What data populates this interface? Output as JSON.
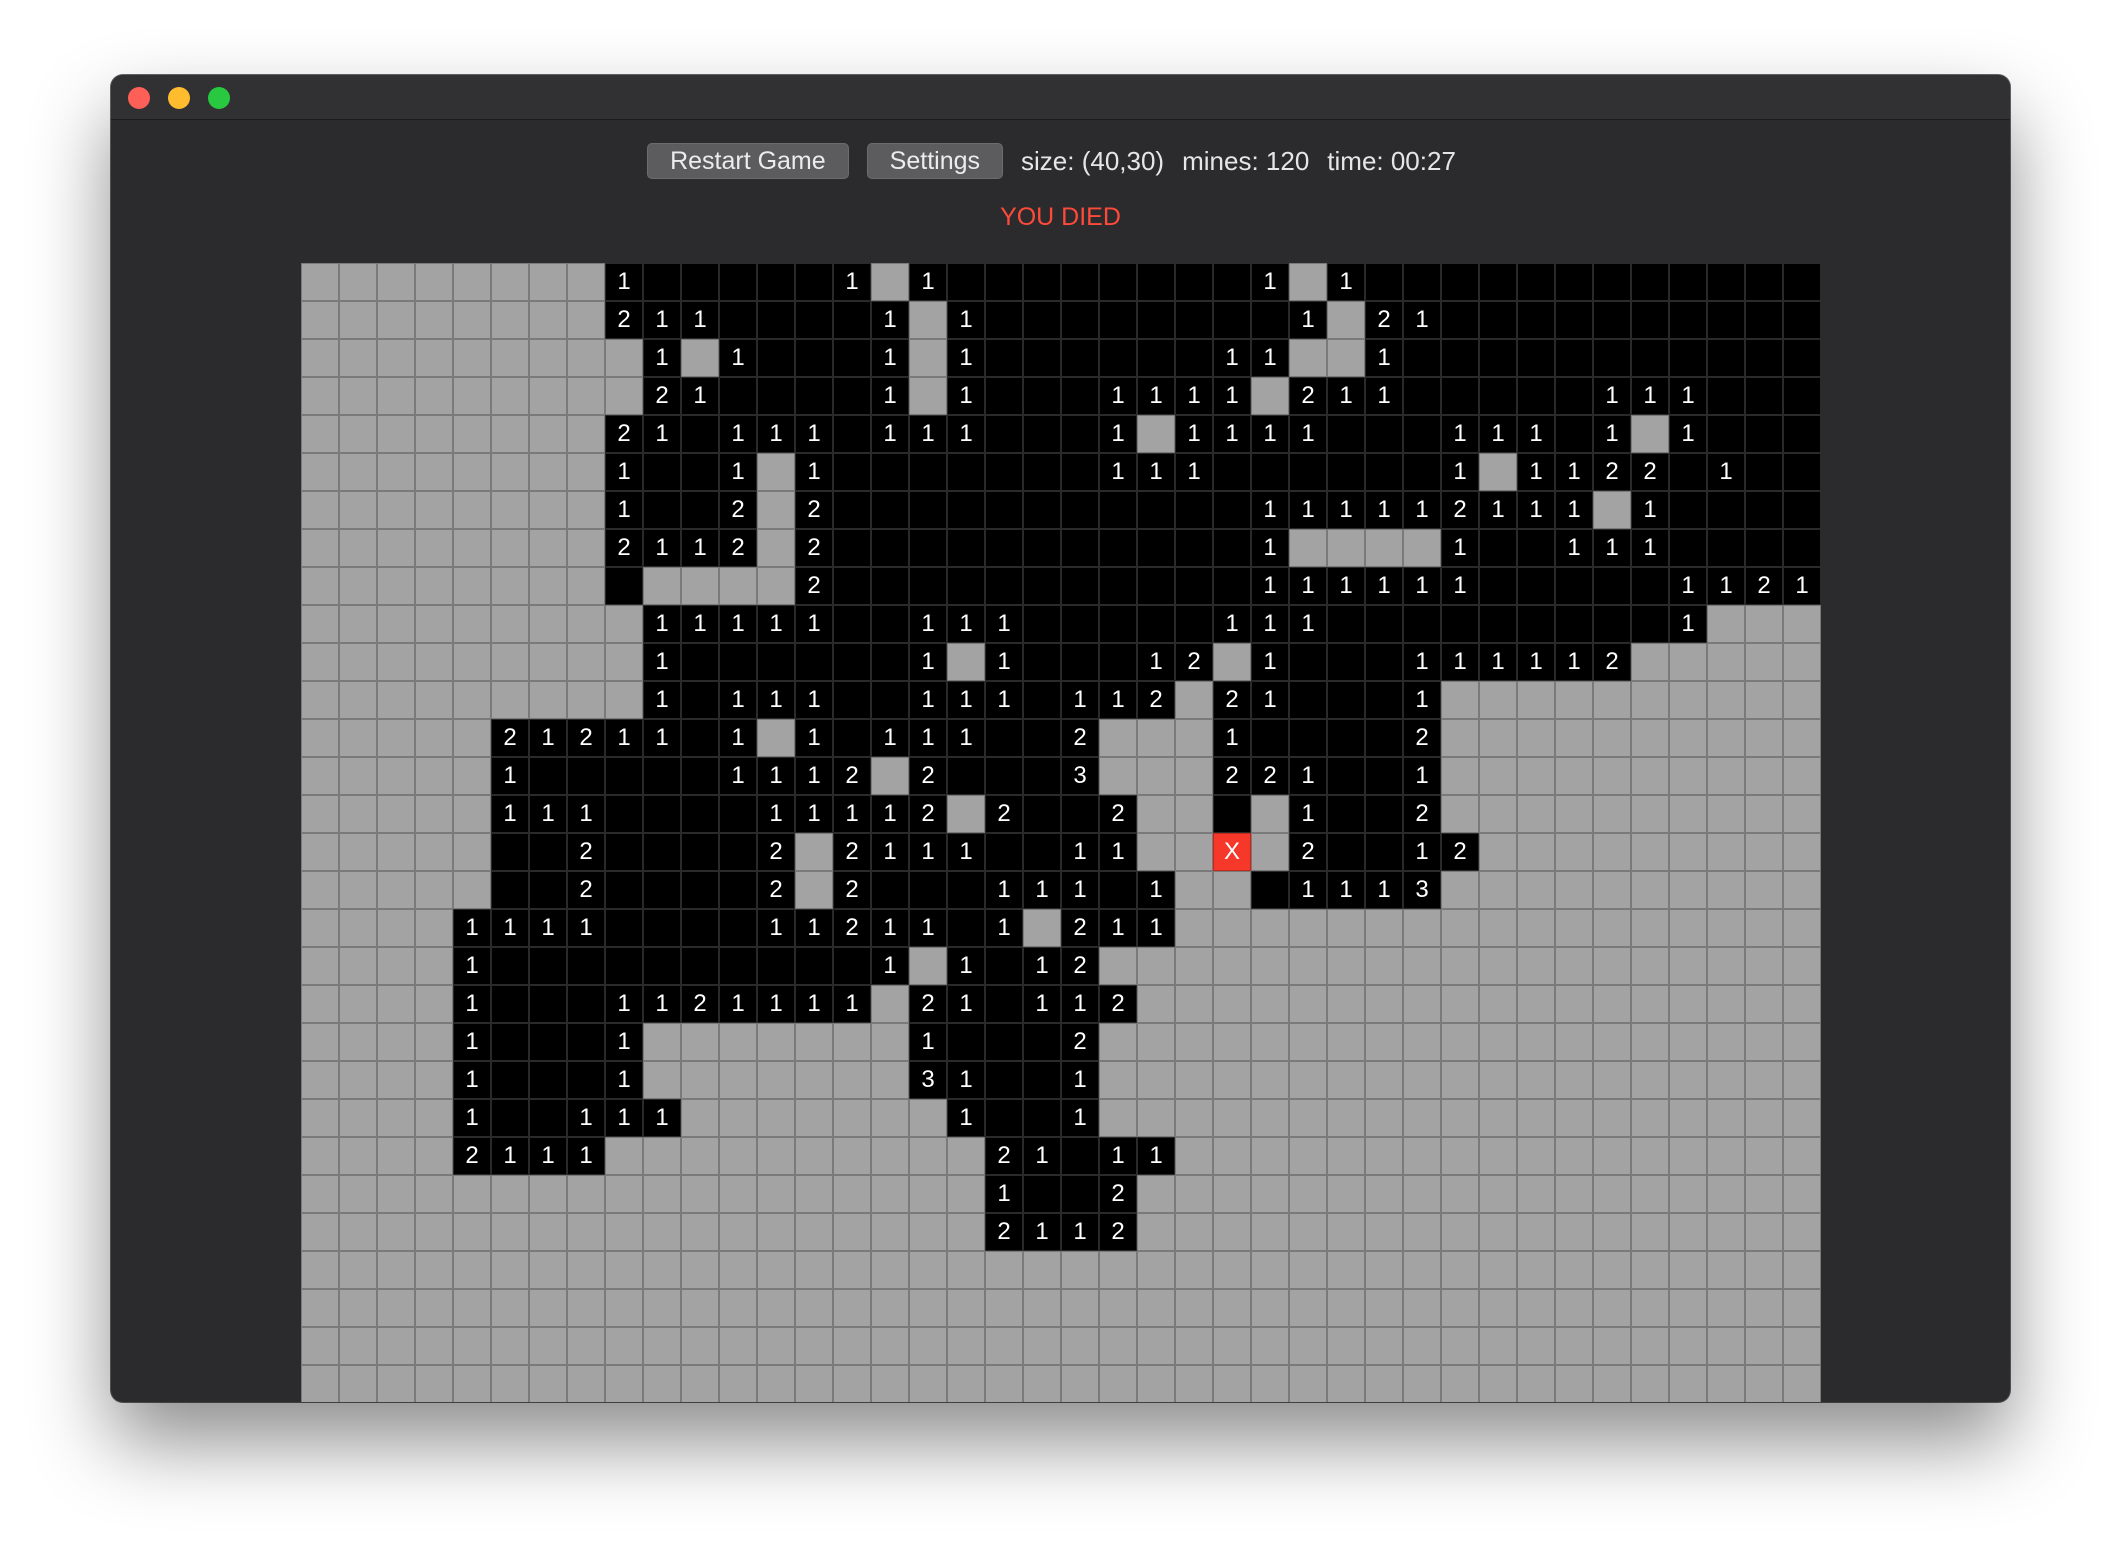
{
  "window": {
    "traffic_lights": [
      "close",
      "minimize",
      "zoom"
    ]
  },
  "toolbar": {
    "restart_label": "Restart Game",
    "settings_label": "Settings",
    "size_text": "size: (40,30)",
    "mines_text": "mines: 120",
    "time_text": "time: 00:27"
  },
  "status": {
    "message": "YOU DIED"
  },
  "board": {
    "columns": 40,
    "rows": 30,
    "legend": {
      "#": "unrevealed",
      ".": "revealed empty",
      "1-9": "revealed number",
      "X": "exploded mine"
    },
    "grid": [
      "########1.....1#1........1#1............",
      "########211....1#1........1#21..........",
      "#########1#1...1#1......11##1...........",
      "#########21....1#1...1111#211.....111...",
      "########21.111.111...1#1111...111.1#1...",
      "########1..1#1.......111......1#1122.1..",
      "########1..2#2...........111112111#1....",
      "########2112#2...........1####1..111....",
      "########.####2...........111111.....1121",
      "#########11111..111.....111.........1###",
      "#########1......1#1...12#1...111112#####",
      "#########1.111..111.112#21...1##########",
      "#####21211.1#1.111..2###1....2##########",
      "#####1.....1112#2...3###221..1##########",
      "#####111....11112#2..2##.#1..2##########",
      "#####..2....2#2111..11##X#2..12#########",
      "#####..2....2#2...111.1##.1113##########",
      "####1111....11211.1#211#################",
      "####1..........1#1.12###################",
      "####1...1121111#21.112##################",
      "####1...1#######1...2###################",
      "####1...1#######31..1###################",
      "####1..111#######1..1###################",
      "####2111##########21.11#################",
      "##################1..2##################",
      "##################2112##################",
      "########################################",
      "########################################",
      "########################################",
      "########################################"
    ]
  }
}
